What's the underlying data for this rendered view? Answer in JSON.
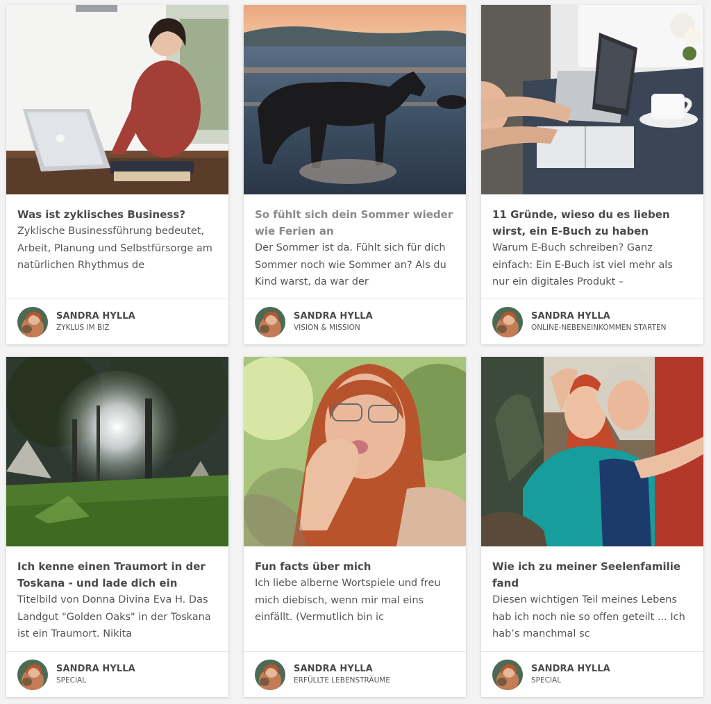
{
  "posts": [
    {
      "title": "Was ist zyklisches Business?",
      "excerpt": "Zyklische Businessführung bedeutet, Arbeit, Planung und Selbstfürsorge am natürlichen Rhythmus de",
      "author": "SANDRA HYLLA",
      "category": "ZYKLUS IM BIZ"
    },
    {
      "title": "So fühlt sich dein Sommer wieder wie Ferien an",
      "excerpt": "Der Sommer ist da. Fühlt sich für dich Sommer noch wie Sommer an? Als du Kind warst, da war der",
      "author": "SANDRA HYLLA",
      "category": "VISION & MISSION"
    },
    {
      "title": "11 Gründe, wieso du es lieben wirst, ein E-Buch zu haben",
      "excerpt": "Warum E-Buch schreiben? Ganz einfach: Ein E-Buch ist viel mehr als nur ein digitales Produkt –",
      "author": "SANDRA HYLLA",
      "category": "ONLINE-NEBENEINKOMMEN STARTEN"
    },
    {
      "title": "Ich kenne einen Traumort in der Toskana - und lade dich ein",
      "excerpt": "Titelbild von Donna Divina Eva H. Das Landgut \"Golden Oaks\" in der Toskana ist ein Traumort. Nikita",
      "author": "SANDRA HYLLA",
      "category": "SPECIAL"
    },
    {
      "title": "Fun facts über mich",
      "excerpt": "Ich liebe alberne Wortspiele und freu mich diebisch, wenn mir mal eins einfällt. (Vermutlich bin ic",
      "author": "SANDRA HYLLA",
      "category": "ERFÜLLTE LEBENSTRÄUME"
    },
    {
      "title": "Wie ich zu meiner Seelenfamilie fand",
      "excerpt": "Diesen wichtigen Teil meines Lebens hab ich noch nie so offen geteilt ... Ich hab’s manchmal sc",
      "author": "SANDRA HYLLA",
      "category": "SPECIAL"
    }
  ]
}
